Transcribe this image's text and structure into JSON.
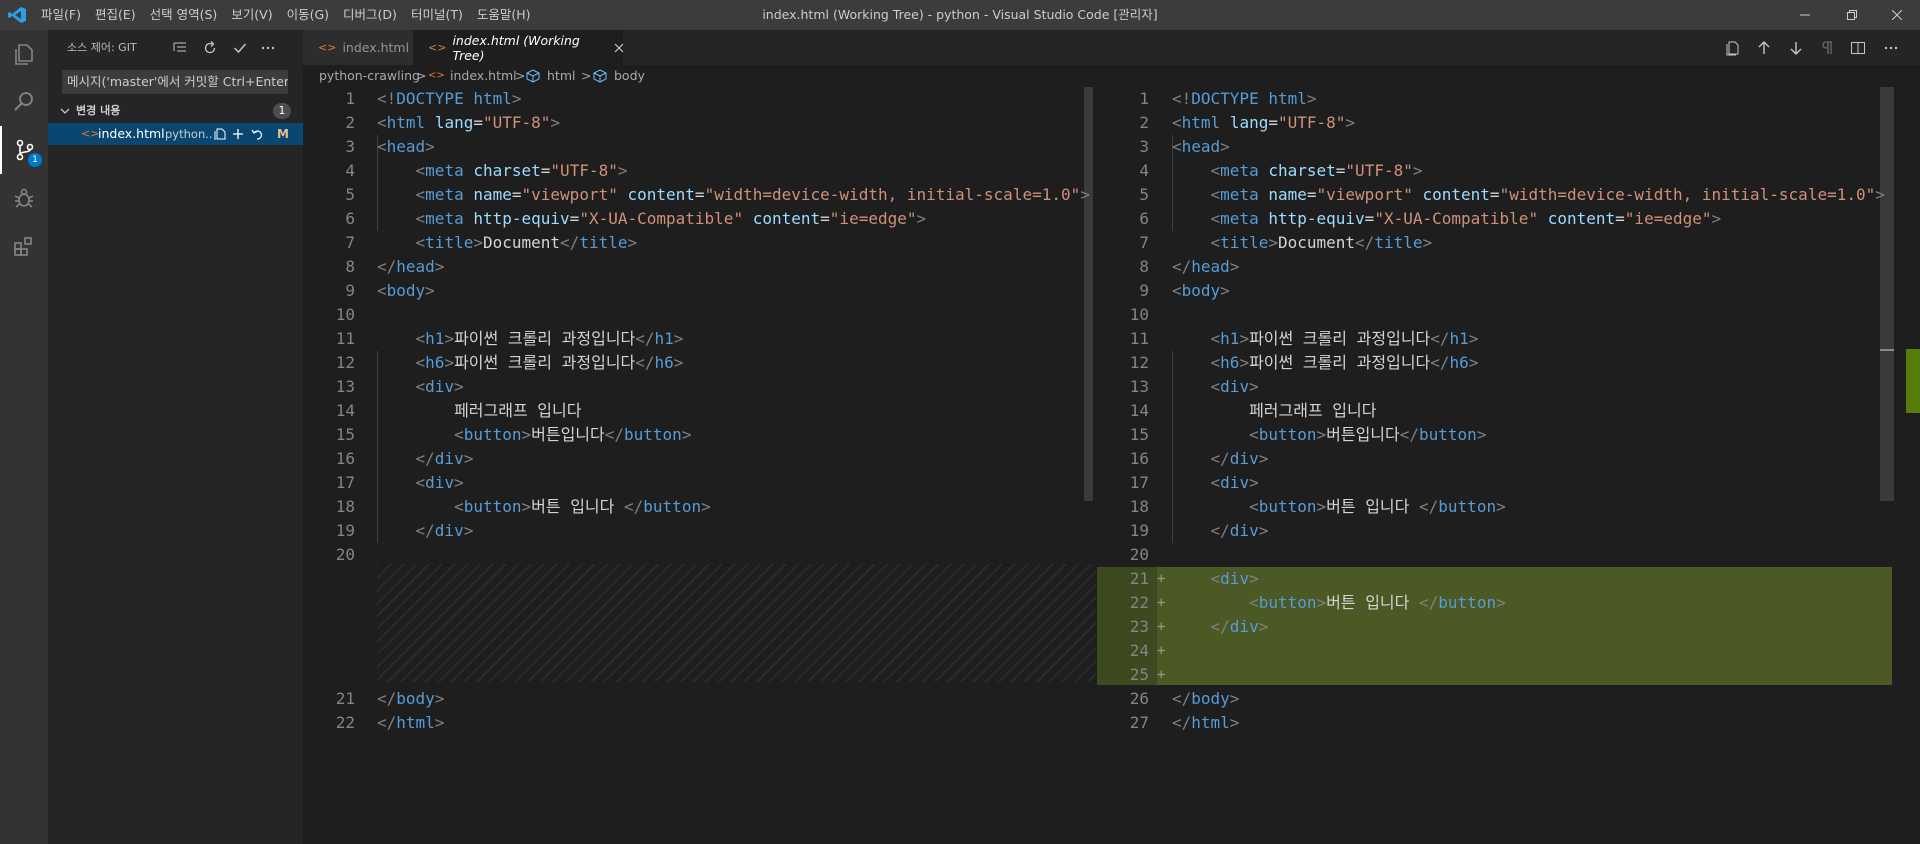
{
  "titlebar": {
    "menu": [
      "파일(F)",
      "편집(E)",
      "선택 영역(S)",
      "보기(V)",
      "이동(G)",
      "디버그(D)",
      "터미널(T)",
      "도움말(H)"
    ],
    "title": "index.html (Working Tree) - python - Visual Studio Code [관리자]"
  },
  "activitybar": {
    "icons": [
      "files-icon",
      "search-icon",
      "source-control-icon",
      "debug-icon",
      "extensions-icon"
    ],
    "scm_badge": "1"
  },
  "sidebar": {
    "title": "소스 제어: GIT",
    "commit_placeholder": "메시지('master'에서 커밋할 Ctrl+Enter)",
    "changes_label": "변경 내용",
    "changes_count": "1",
    "file": {
      "name": "index.html",
      "path": "python...",
      "status": "M"
    }
  },
  "tabs": [
    {
      "label": "index.html",
      "active": false
    },
    {
      "label": "index.html (Working Tree)",
      "active": true
    }
  ],
  "breadcrumb": [
    "python-crawling",
    "index.html",
    "html",
    "body"
  ],
  "left_editor": {
    "lines": [
      {
        "n": "1",
        "code": "<!DOCTYPE html>"
      },
      {
        "n": "2",
        "code": "<html lang=\"UTF-8\">"
      },
      {
        "n": "3",
        "code": "<head>"
      },
      {
        "n": "4",
        "code": "    <meta charset=\"UTF-8\">"
      },
      {
        "n": "5",
        "code": "    <meta name=\"viewport\" content=\"width=device-width, initial-scale=1.0\">"
      },
      {
        "n": "6",
        "code": "    <meta http-equiv=\"X-UA-Compatible\" content=\"ie=edge\">"
      },
      {
        "n": "7",
        "code": "    <title>Document</title>"
      },
      {
        "n": "8",
        "code": "</head>"
      },
      {
        "n": "9",
        "code": "<body>"
      },
      {
        "n": "10",
        "code": ""
      },
      {
        "n": "11",
        "code": "    <h1>파이썬 크롤리 과정입니다</h1>"
      },
      {
        "n": "12",
        "code": "    <h6>파이썬 크롤리 과정입니다</h6>"
      },
      {
        "n": "13",
        "code": "    <div>"
      },
      {
        "n": "14",
        "code": "        페러그래프 입니다"
      },
      {
        "n": "15",
        "code": "        <button>버튼입니다</button>"
      },
      {
        "n": "16",
        "code": "    </div>"
      },
      {
        "n": "17",
        "code": "    <div>"
      },
      {
        "n": "18",
        "code": "        <button>버튼 입니다 </button>"
      },
      {
        "n": "19",
        "code": "    </div>"
      },
      {
        "n": "20",
        "code": ""
      },
      {
        "n": "21",
        "code": "</body>"
      },
      {
        "n": "22",
        "code": "</html>"
      }
    ]
  },
  "right_editor": {
    "lines": [
      {
        "n": "1",
        "code": "<!DOCTYPE html>"
      },
      {
        "n": "2",
        "code": "<html lang=\"UTF-8\">"
      },
      {
        "n": "3",
        "code": "<head>"
      },
      {
        "n": "4",
        "code": "    <meta charset=\"UTF-8\">"
      },
      {
        "n": "5",
        "code": "    <meta name=\"viewport\" content=\"width=device-width, initial-scale=1.0\">"
      },
      {
        "n": "6",
        "code": "    <meta http-equiv=\"X-UA-Compatible\" content=\"ie=edge\">"
      },
      {
        "n": "7",
        "code": "    <title>Document</title>"
      },
      {
        "n": "8",
        "code": "</head>"
      },
      {
        "n": "9",
        "code": "<body>"
      },
      {
        "n": "10",
        "code": ""
      },
      {
        "n": "11",
        "code": "    <h1>파이썬 크롤리 과정입니다</h1>"
      },
      {
        "n": "12",
        "code": "    <h6>파이썬 크롤리 과정입니다</h6>"
      },
      {
        "n": "13",
        "code": "    <div>"
      },
      {
        "n": "14",
        "code": "        페러그래프 입니다"
      },
      {
        "n": "15",
        "code": "        <button>버튼입니다</button>"
      },
      {
        "n": "16",
        "code": "    </div>"
      },
      {
        "n": "17",
        "code": "    <div>"
      },
      {
        "n": "18",
        "code": "        <button>버튼 입니다 </button>"
      },
      {
        "n": "19",
        "code": "    </div>"
      },
      {
        "n": "20",
        "code": ""
      },
      {
        "n": "21",
        "code": "    <div>",
        "added": true
      },
      {
        "n": "22",
        "code": "        <button>버튼 입니다 </button>",
        "added": true
      },
      {
        "n": "23",
        "code": "    </div>",
        "added": true
      },
      {
        "n": "24",
        "code": "",
        "added": true
      },
      {
        "n": "25",
        "code": "",
        "added": true
      },
      {
        "n": "26",
        "code": "</body>"
      },
      {
        "n": "27",
        "code": "</html>"
      }
    ]
  },
  "colors": {
    "accent": "#007acc",
    "added": "#4b5a25",
    "modified": "#e2c08d"
  }
}
